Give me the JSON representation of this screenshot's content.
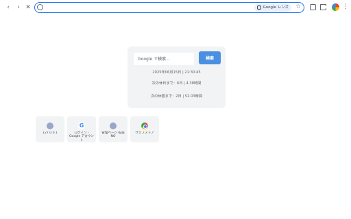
{
  "toolbar": {
    "back_icon": "‹",
    "forward_icon": "›",
    "stop_icon": "✕",
    "omnibox_value": "",
    "lens_label": "Google レンズ",
    "star_icon": "☆",
    "menu_icon": "⋮"
  },
  "panel": {
    "search_placeholder": "Google で検索...",
    "search_button": "検索",
    "date_line": "2025年06月15日 | 21:30:45",
    "next_holiday": "次の休日まで：6日 | 4.38時間",
    "next_break": "次の休憩まで：2日 | 52.03時間"
  },
  "shortcuts": [
    {
      "label": "127.0.0.1",
      "icon": "globe-icon"
    },
    {
      "label": "ログイン - Google アカウント",
      "icon": "google-icon"
    },
    {
      "label": "管理ページ 拡張 NO",
      "icon": "globe-icon"
    },
    {
      "label": "ウェブストア",
      "icon": "chrome-icon"
    }
  ],
  "colors": {
    "accent": "#1a73e8",
    "search_button": "#4a90e2",
    "panel_bg": "#f1f3f4"
  }
}
